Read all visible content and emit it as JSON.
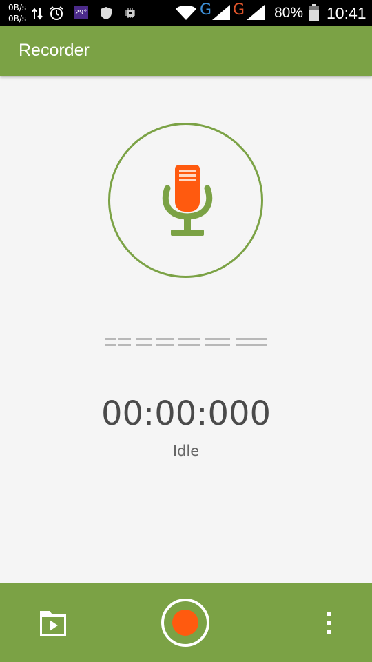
{
  "status_bar": {
    "net_up": "0B/s",
    "net_down": "0B/s",
    "temperature": "29°",
    "carrier1": "G",
    "carrier2": "G",
    "battery": "80%",
    "time": "10:41",
    "icons": [
      "data-transfer-icon",
      "alarm-icon",
      "shield-icon",
      "chip-icon",
      "wifi-icon",
      "signal-icon",
      "battery-icon"
    ]
  },
  "app_bar": {
    "title": "Recorder"
  },
  "recorder": {
    "mic_icon": "microphone-icon",
    "timer": "00:00:000",
    "state": "Idle"
  },
  "bottom_bar": {
    "recordings_icon": "folder-play-icon",
    "record_icon": "record-icon",
    "more_icon": "more-vert-icon"
  },
  "colors": {
    "primary": "#7ba245",
    "accent": "#ff5a0f",
    "background": "#f5f5f5",
    "carrier1": "#3d8fd6",
    "carrier2": "#e0552b"
  }
}
